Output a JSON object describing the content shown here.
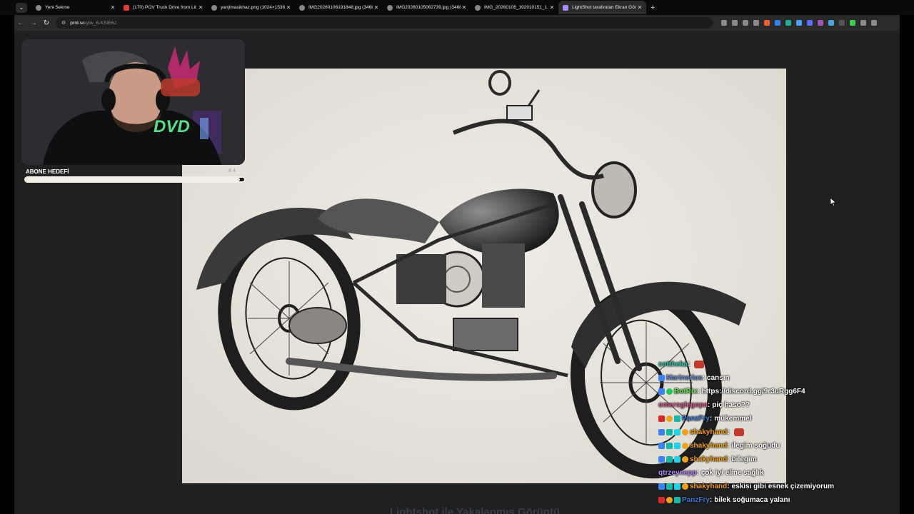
{
  "browser": {
    "tabs": [
      {
        "title": "Yeni Sekme",
        "favicon": "globe-icon"
      },
      {
        "title": "(170) POV Truck Drive from Lit",
        "favicon": "youtube-icon"
      },
      {
        "title": "yanjlmasikhaz.png (1024×1536)",
        "favicon": "globe-icon"
      },
      {
        "title": "IMG20260106191848.jpg (3468",
        "favicon": "globe-icon"
      },
      {
        "title": "IMG20260105062739.jpg (3468",
        "favicon": "globe-icon"
      },
      {
        "title": "IMG_20260106_192910151_1.jp",
        "favicon": "globe-icon"
      },
      {
        "title": "LightShot tarafından Ekran Gör",
        "favicon": "lightshot-icon"
      }
    ],
    "address": {
      "domain": "prnt.sc",
      "path": "/ytw_6-KSlE6J"
    },
    "ext_colors": [
      "#8a8a8a",
      "#8a8a8a",
      "#8a8a8a",
      "#8a8a8a",
      "#e8622c",
      "#2f80ed",
      "#1fae9d",
      "#4a9eff",
      "#5b6cff",
      "#9b59b6",
      "#4aa3df",
      "#555",
      "#3ecf4f",
      "#8a8a8a",
      "#8a8a8a"
    ]
  },
  "stream": {
    "goal_label": "ABONE HEDEFİ",
    "goal_count": "8 4",
    "goal_fill": 0.98
  },
  "page": {
    "caption": "Lightshot ile Yakalanmış Görüntü"
  },
  "chat": [
    {
      "badges": [],
      "user": "cottheka",
      "color": "#2ec4a6",
      "sep": ":",
      "text": "",
      "emote": true
    },
    {
      "badges": [
        "b-blue"
      ],
      "user": "Marinerius",
      "color": "#6b8fd6",
      "sep": ":",
      "text": "cansın"
    },
    {
      "badges": [
        "b-blue",
        "b-green"
      ],
      "user": "BotRix",
      "color": "#6ee860",
      "sep": ":",
      "text": "https://discord.gg/9r3uRgg6F4"
    },
    {
      "badges": [],
      "user": "omeroglegopa",
      "color": "#d15b8f",
      "sep": ":",
      "text": "piç haso??"
    },
    {
      "badges": [
        "b-red",
        "b-gold",
        "b-teal"
      ],
      "user": "PanzFry",
      "color": "#3a7bd5",
      "sep": ":",
      "text": "mükemmel"
    },
    {
      "badges": [
        "b-blue",
        "b-teal",
        "b-cyan",
        "b-gold"
      ],
      "user": "shakyhand",
      "color": "#f2a01a",
      "sep": ":",
      "text": "",
      "emote": true
    },
    {
      "badges": [
        "b-blue",
        "b-teal",
        "b-cyan",
        "b-gold"
      ],
      "user": "shakyhand",
      "color": "#f2a01a",
      "sep": ":",
      "text": "ilegim soğudu"
    },
    {
      "badges": [
        "b-blue",
        "b-teal",
        "b-cyan",
        "b-gold"
      ],
      "user": "shakyhand",
      "color": "#f2a01a",
      "sep": ":",
      "text": "bilegim"
    },
    {
      "badges": [],
      "user": "qtrzeynepp",
      "color": "#b388ff",
      "sep": ":",
      "text": "çok iyi eline sağlık"
    },
    {
      "badges": [
        "b-blue",
        "b-teal",
        "b-cyan",
        "b-gold"
      ],
      "user": "shakyhand",
      "color": "#f2a01a",
      "sep": ":",
      "text": "eskisi gibi esnek çizemiyorum"
    },
    {
      "badges": [
        "b-red",
        "b-gold",
        "b-teal"
      ],
      "user": "PanzFry",
      "color": "#3a7bd5",
      "sep": ":",
      "text": "bilek soğumaca yalanı"
    }
  ]
}
